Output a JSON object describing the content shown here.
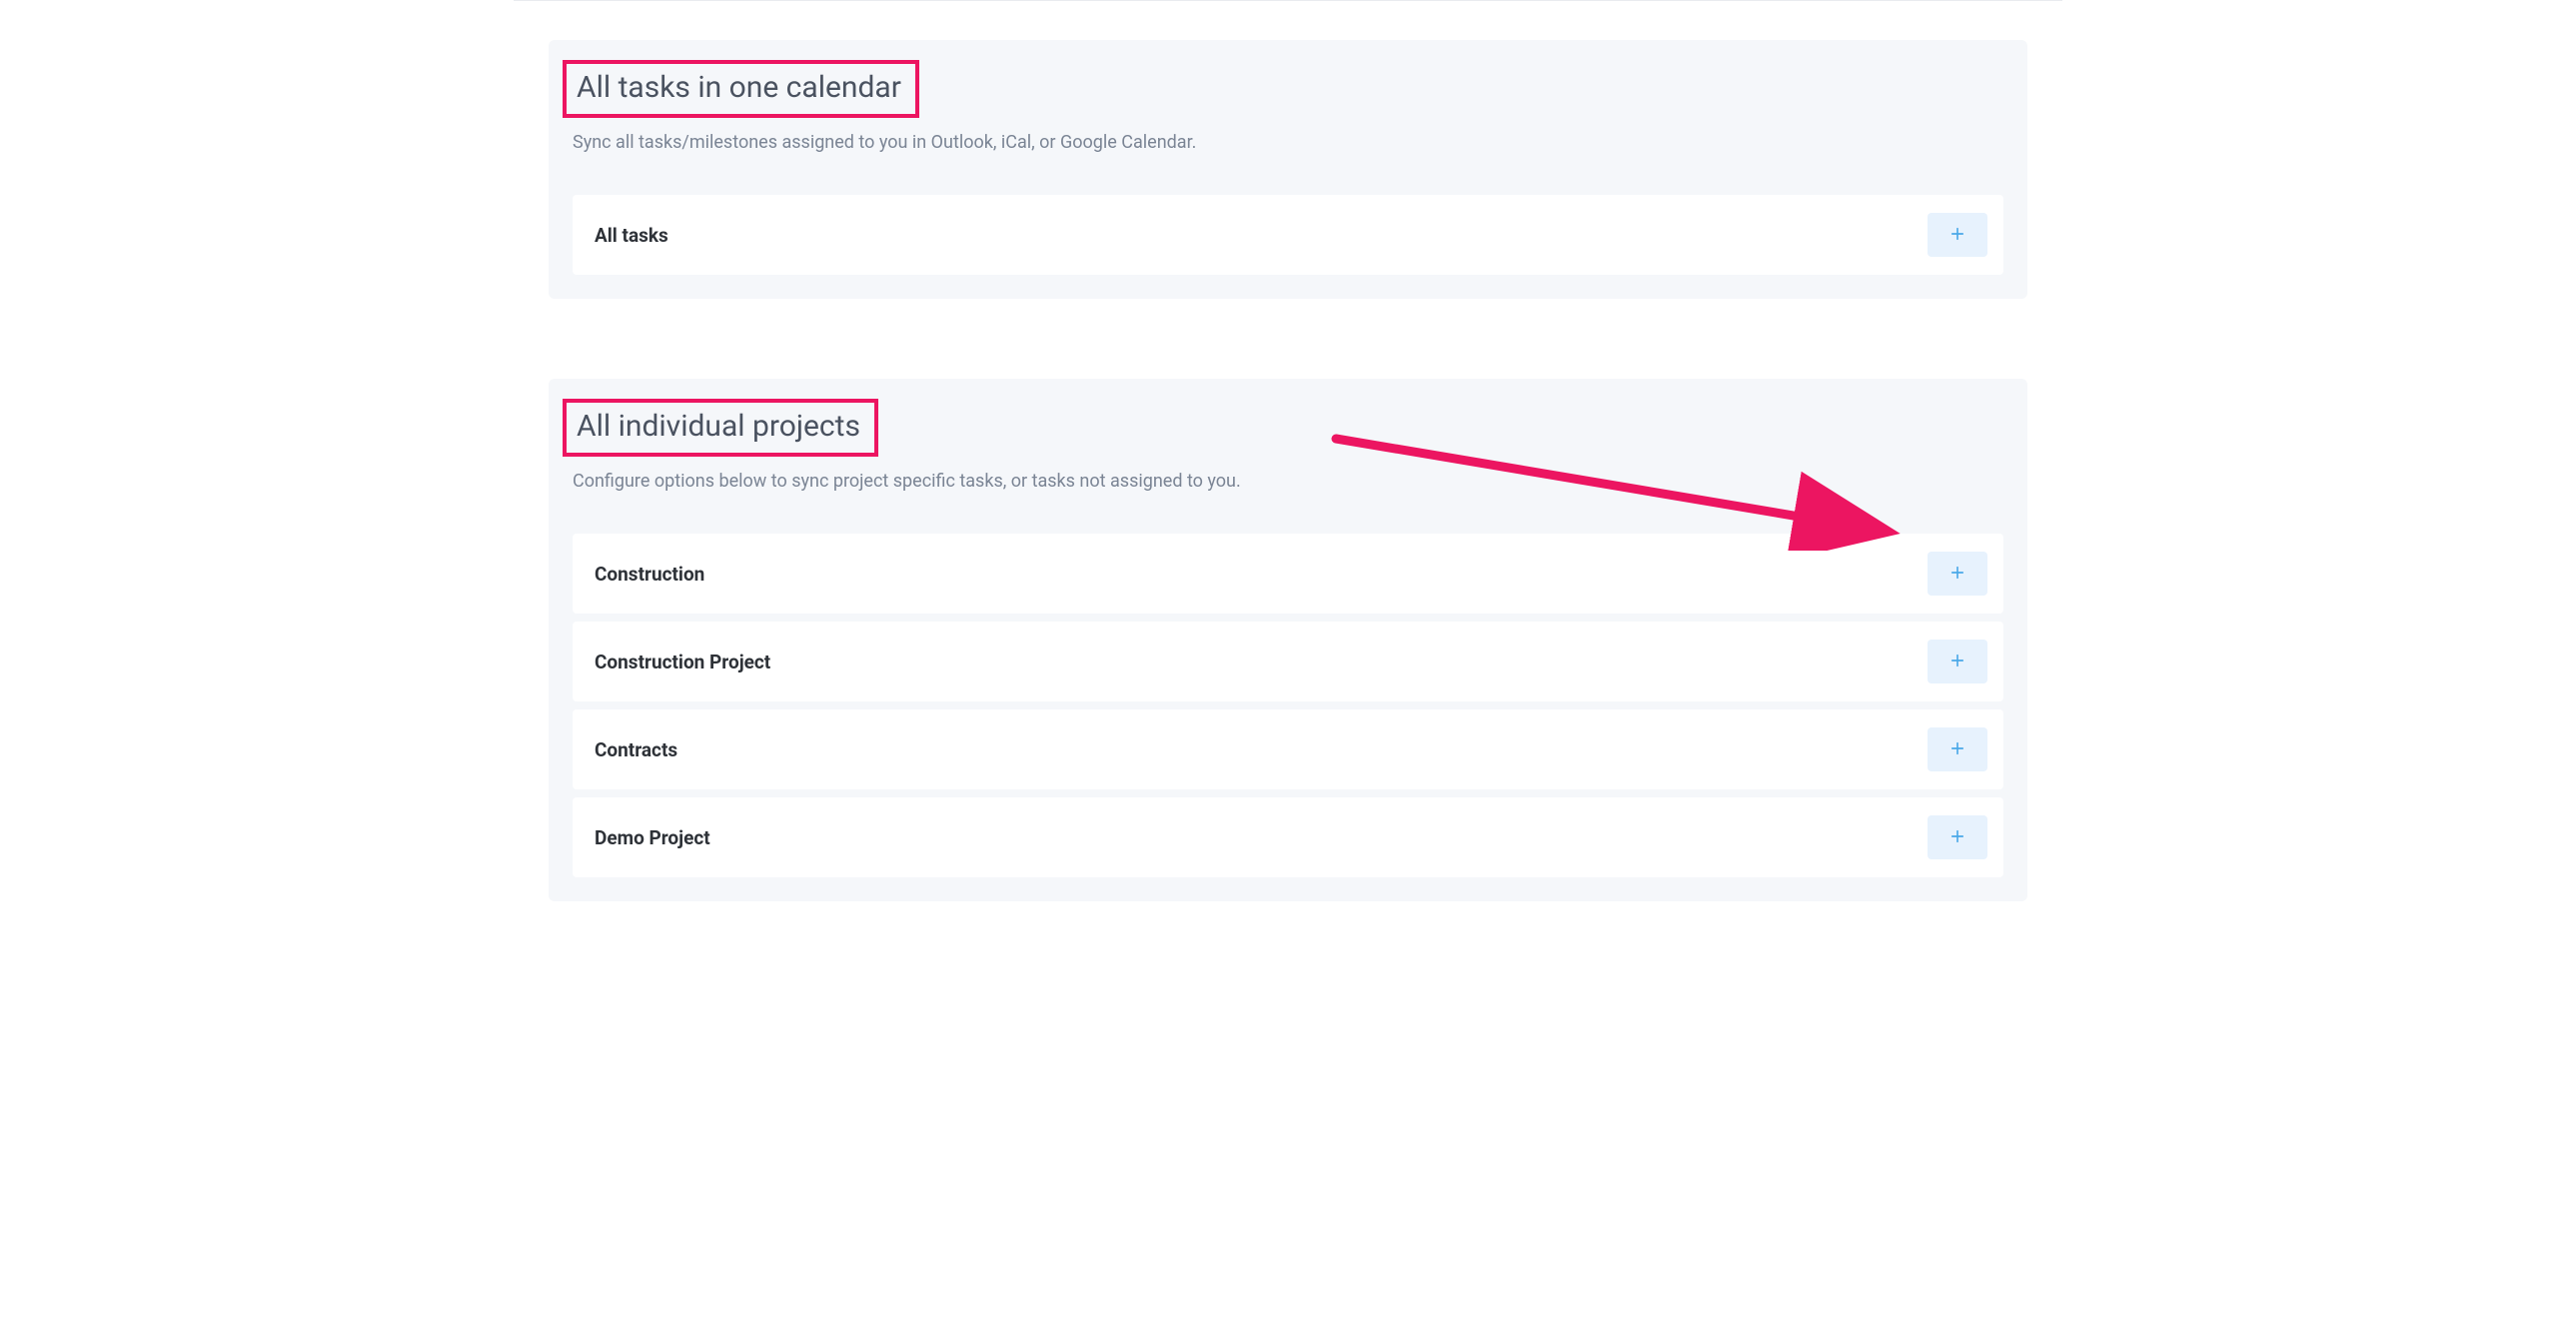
{
  "sections": {
    "all_tasks": {
      "title": "All tasks in one calendar",
      "description": "Sync all tasks/milestones assigned to you in Outlook, iCal, or Google Calendar.",
      "items": [
        {
          "label": "All tasks"
        }
      ]
    },
    "individual_projects": {
      "title": "All individual projects",
      "description": "Configure options below to sync project specific tasks, or tasks not assigned to you.",
      "items": [
        {
          "label": "Construction"
        },
        {
          "label": "Construction Project"
        },
        {
          "label": "Contracts"
        },
        {
          "label": "Demo Project"
        }
      ]
    }
  },
  "annotations": {
    "highlight_color": "#ec1561"
  }
}
